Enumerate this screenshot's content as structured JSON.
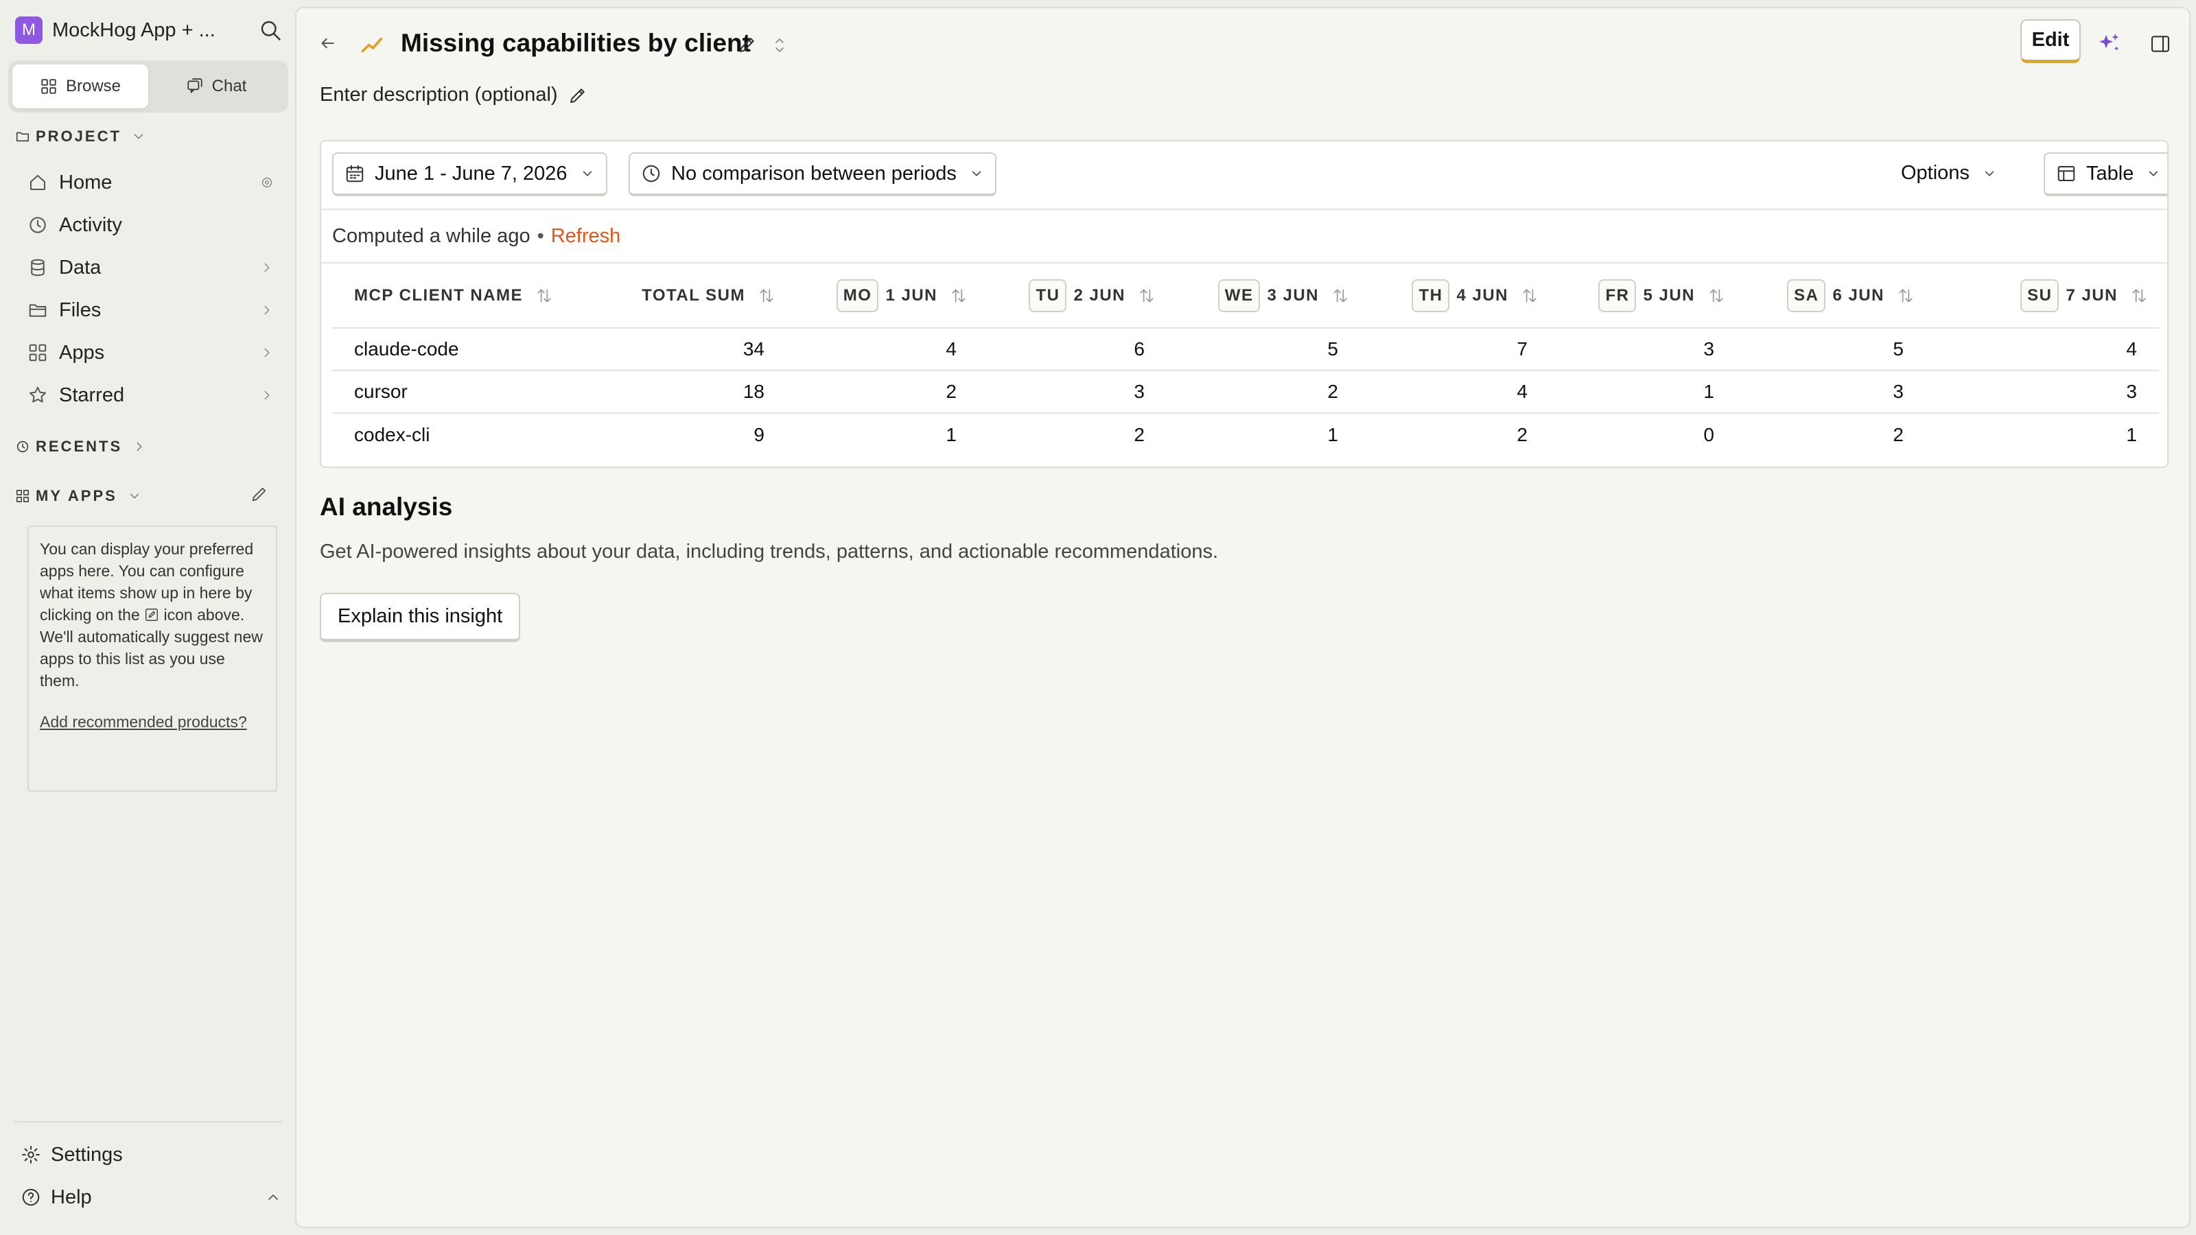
{
  "workspace": {
    "initial": "M",
    "name": "MockHog App + ..."
  },
  "sidebar": {
    "tabs": [
      {
        "label": "Browse"
      },
      {
        "label": "Chat"
      }
    ],
    "project_header": "PROJECT",
    "nav_items": [
      {
        "label": "Home",
        "icon": "home-icon"
      },
      {
        "label": "Activity",
        "icon": "clock-icon"
      },
      {
        "label": "Data",
        "icon": "database-icon"
      },
      {
        "label": "Files",
        "icon": "folder-icon"
      },
      {
        "label": "Apps",
        "icon": "apps-icon"
      },
      {
        "label": "Starred",
        "icon": "star-icon"
      }
    ],
    "recents_header": "RECENTS",
    "myapps_header": "MY APPS",
    "myapps_note_1": "You can display your preferred apps here. You can configure what items show up in here by clicking on the",
    "myapps_note_2": "icon above. We'll automatically suggest new apps to this list as you use them.",
    "myapps_link": "Add recommended products?",
    "footer": {
      "settings": "Settings",
      "help": "Help"
    }
  },
  "header": {
    "title": "Missing capabilities by client",
    "edit_label": "Edit",
    "description": "Enter description (optional)"
  },
  "toolbar": {
    "date_range": "June 1 - June 7, 2026",
    "comparison": "No comparison between periods",
    "options": "Options",
    "view": "Table"
  },
  "status": {
    "computed": "Computed a while ago",
    "separator": "•",
    "refresh": "Refresh"
  },
  "table": {
    "col_name": "MCP CLIENT NAME",
    "col_total": "TOTAL SUM",
    "days": [
      {
        "dow": "MO",
        "date": "1 JUN"
      },
      {
        "dow": "TU",
        "date": "2 JUN"
      },
      {
        "dow": "WE",
        "date": "3 JUN"
      },
      {
        "dow": "TH",
        "date": "4 JUN"
      },
      {
        "dow": "FR",
        "date": "5 JUN"
      },
      {
        "dow": "SA",
        "date": "6 JUN"
      },
      {
        "dow": "SU",
        "date": "7 JUN"
      }
    ],
    "rows": [
      {
        "name": "claude-code",
        "total": "34",
        "values": [
          "4",
          "6",
          "5",
          "7",
          "3",
          "5",
          "4"
        ]
      },
      {
        "name": "cursor",
        "total": "18",
        "values": [
          "2",
          "3",
          "2",
          "4",
          "1",
          "3",
          "3"
        ]
      },
      {
        "name": "codex-cli",
        "total": "9",
        "values": [
          "1",
          "2",
          "1",
          "2",
          "0",
          "2",
          "1"
        ]
      }
    ]
  },
  "ai": {
    "heading": "AI analysis",
    "description": "Get AI-powered insights about your data, including trends, patterns, and actionable recommendations.",
    "button": "Explain this insight"
  },
  "colors": {
    "accent": "#e0a52b",
    "refresh": "#e0561a",
    "workspace": "#8f58e0",
    "ai": "#7a4fd6"
  }
}
